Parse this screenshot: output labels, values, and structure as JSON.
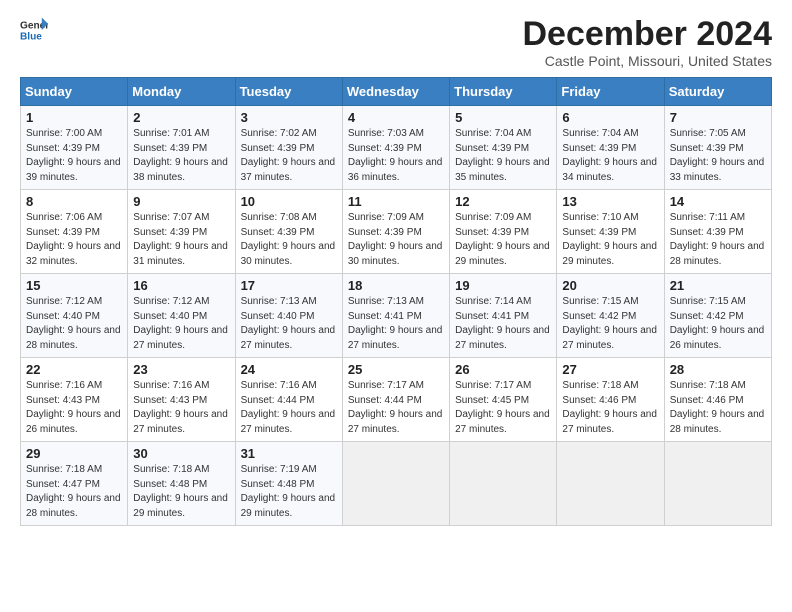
{
  "logo": {
    "line1": "General",
    "line2": "Blue"
  },
  "title": "December 2024",
  "location": "Castle Point, Missouri, United States",
  "days_of_week": [
    "Sunday",
    "Monday",
    "Tuesday",
    "Wednesday",
    "Thursday",
    "Friday",
    "Saturday"
  ],
  "weeks": [
    [
      {
        "day": "1",
        "sunrise": "7:00 AM",
        "sunset": "4:39 PM",
        "daylight": "9 hours and 39 minutes."
      },
      {
        "day": "2",
        "sunrise": "7:01 AM",
        "sunset": "4:39 PM",
        "daylight": "9 hours and 38 minutes."
      },
      {
        "day": "3",
        "sunrise": "7:02 AM",
        "sunset": "4:39 PM",
        "daylight": "9 hours and 37 minutes."
      },
      {
        "day": "4",
        "sunrise": "7:03 AM",
        "sunset": "4:39 PM",
        "daylight": "9 hours and 36 minutes."
      },
      {
        "day": "5",
        "sunrise": "7:04 AM",
        "sunset": "4:39 PM",
        "daylight": "9 hours and 35 minutes."
      },
      {
        "day": "6",
        "sunrise": "7:04 AM",
        "sunset": "4:39 PM",
        "daylight": "9 hours and 34 minutes."
      },
      {
        "day": "7",
        "sunrise": "7:05 AM",
        "sunset": "4:39 PM",
        "daylight": "9 hours and 33 minutes."
      }
    ],
    [
      {
        "day": "8",
        "sunrise": "7:06 AM",
        "sunset": "4:39 PM",
        "daylight": "9 hours and 32 minutes."
      },
      {
        "day": "9",
        "sunrise": "7:07 AM",
        "sunset": "4:39 PM",
        "daylight": "9 hours and 31 minutes."
      },
      {
        "day": "10",
        "sunrise": "7:08 AM",
        "sunset": "4:39 PM",
        "daylight": "9 hours and 30 minutes."
      },
      {
        "day": "11",
        "sunrise": "7:09 AM",
        "sunset": "4:39 PM",
        "daylight": "9 hours and 30 minutes."
      },
      {
        "day": "12",
        "sunrise": "7:09 AM",
        "sunset": "4:39 PM",
        "daylight": "9 hours and 29 minutes."
      },
      {
        "day": "13",
        "sunrise": "7:10 AM",
        "sunset": "4:39 PM",
        "daylight": "9 hours and 29 minutes."
      },
      {
        "day": "14",
        "sunrise": "7:11 AM",
        "sunset": "4:39 PM",
        "daylight": "9 hours and 28 minutes."
      }
    ],
    [
      {
        "day": "15",
        "sunrise": "7:12 AM",
        "sunset": "4:40 PM",
        "daylight": "9 hours and 28 minutes."
      },
      {
        "day": "16",
        "sunrise": "7:12 AM",
        "sunset": "4:40 PM",
        "daylight": "9 hours and 27 minutes."
      },
      {
        "day": "17",
        "sunrise": "7:13 AM",
        "sunset": "4:40 PM",
        "daylight": "9 hours and 27 minutes."
      },
      {
        "day": "18",
        "sunrise": "7:13 AM",
        "sunset": "4:41 PM",
        "daylight": "9 hours and 27 minutes."
      },
      {
        "day": "19",
        "sunrise": "7:14 AM",
        "sunset": "4:41 PM",
        "daylight": "9 hours and 27 minutes."
      },
      {
        "day": "20",
        "sunrise": "7:15 AM",
        "sunset": "4:42 PM",
        "daylight": "9 hours and 27 minutes."
      },
      {
        "day": "21",
        "sunrise": "7:15 AM",
        "sunset": "4:42 PM",
        "daylight": "9 hours and 26 minutes."
      }
    ],
    [
      {
        "day": "22",
        "sunrise": "7:16 AM",
        "sunset": "4:43 PM",
        "daylight": "9 hours and 26 minutes."
      },
      {
        "day": "23",
        "sunrise": "7:16 AM",
        "sunset": "4:43 PM",
        "daylight": "9 hours and 27 minutes."
      },
      {
        "day": "24",
        "sunrise": "7:16 AM",
        "sunset": "4:44 PM",
        "daylight": "9 hours and 27 minutes."
      },
      {
        "day": "25",
        "sunrise": "7:17 AM",
        "sunset": "4:44 PM",
        "daylight": "9 hours and 27 minutes."
      },
      {
        "day": "26",
        "sunrise": "7:17 AM",
        "sunset": "4:45 PM",
        "daylight": "9 hours and 27 minutes."
      },
      {
        "day": "27",
        "sunrise": "7:18 AM",
        "sunset": "4:46 PM",
        "daylight": "9 hours and 27 minutes."
      },
      {
        "day": "28",
        "sunrise": "7:18 AM",
        "sunset": "4:46 PM",
        "daylight": "9 hours and 28 minutes."
      }
    ],
    [
      {
        "day": "29",
        "sunrise": "7:18 AM",
        "sunset": "4:47 PM",
        "daylight": "9 hours and 28 minutes."
      },
      {
        "day": "30",
        "sunrise": "7:18 AM",
        "sunset": "4:48 PM",
        "daylight": "9 hours and 29 minutes."
      },
      {
        "day": "31",
        "sunrise": "7:19 AM",
        "sunset": "4:48 PM",
        "daylight": "9 hours and 29 minutes."
      },
      null,
      null,
      null,
      null
    ]
  ],
  "labels": {
    "sunrise": "Sunrise:",
    "sunset": "Sunset:",
    "daylight": "Daylight:"
  }
}
